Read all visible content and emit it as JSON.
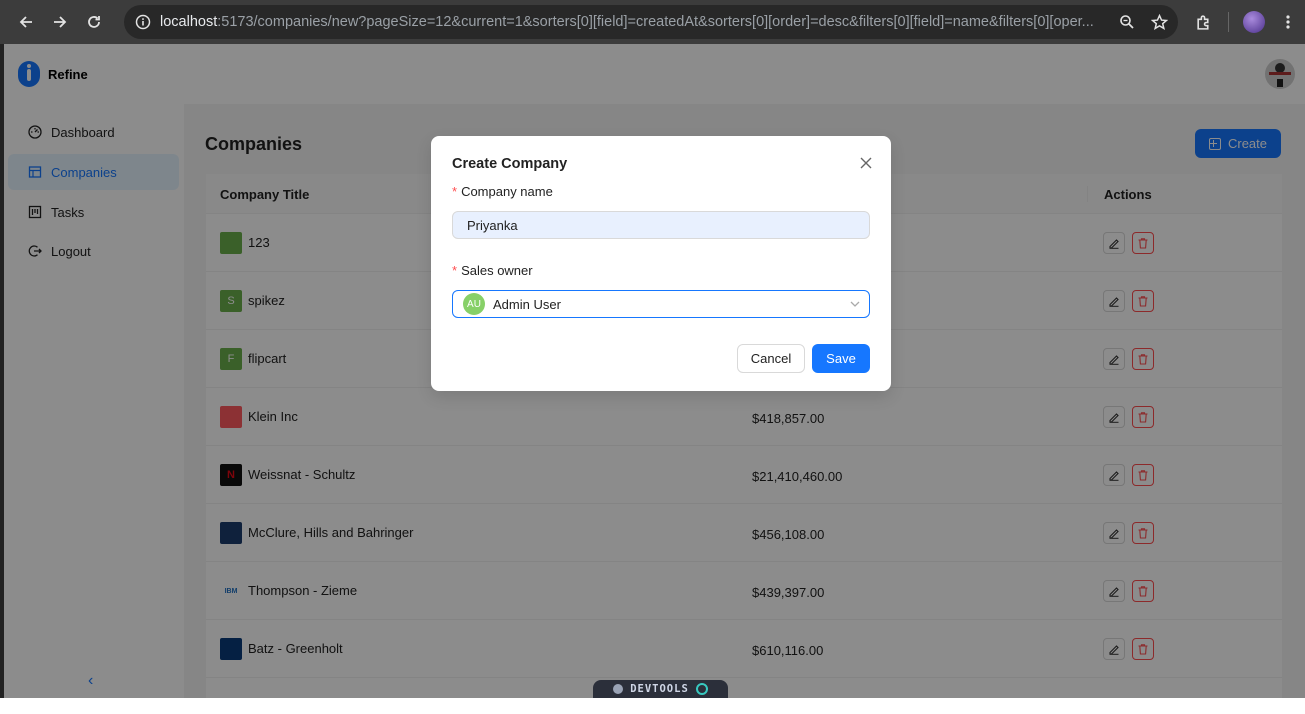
{
  "browser": {
    "url_host": "localhost",
    "url_rest": ":5173/companies/new?pageSize=12&current=1&sorters[0][field]=createdAt&sorters[0][order]=desc&filters[0][field]=name&filters[0][oper..."
  },
  "app": {
    "brand": "Refine",
    "sidebar": {
      "items": [
        {
          "label": "Dashboard",
          "icon": "dashboard-icon"
        },
        {
          "label": "Companies",
          "icon": "companies-icon",
          "active": true
        },
        {
          "label": "Tasks",
          "icon": "tasks-icon"
        },
        {
          "label": "Logout",
          "icon": "logout-icon"
        }
      ],
      "collapse": "‹"
    },
    "page_title": "Companies",
    "create_label": "Create",
    "table": {
      "col_title": "Company Title",
      "col_actions": "Actions",
      "rows": [
        {
          "name": "123",
          "amount": "",
          "logo_text": "",
          "logo_color": "#6ab04c"
        },
        {
          "name": "spikez",
          "amount": "",
          "logo_text": "S",
          "logo_color": "#6ab04c"
        },
        {
          "name": "flipcart",
          "amount": "",
          "logo_text": "F",
          "logo_color": "#6ab04c"
        },
        {
          "name": "Klein Inc",
          "amount": "$418,857.00",
          "logo_text": "",
          "logo_color": "#ff5a5f"
        },
        {
          "name": "Weissnat - Schultz",
          "amount": "$21,410,460.00",
          "logo_text": "N",
          "logo_color": "#111111"
        },
        {
          "name": "McClure, Hills and Bahringer",
          "amount": "$456,108.00",
          "logo_text": "",
          "logo_color": "#1c3d6e"
        },
        {
          "name": "Thompson - Zieme",
          "amount": "$439,397.00",
          "logo_text": "IBM",
          "logo_color": "#ffffff"
        },
        {
          "name": "Batz - Greenholt",
          "amount": "$610,116.00",
          "logo_text": "",
          "logo_color": "#0a3b7a"
        }
      ]
    }
  },
  "modal": {
    "title": "Create Company",
    "name_label": "Company name",
    "name_value": "Priyanka",
    "owner_label": "Sales owner",
    "owner_initials": "AU",
    "owner_value": "Admin User",
    "cancel_label": "Cancel",
    "save_label": "Save",
    "required_mark": "*"
  },
  "devtools_label": "DEVTOOLS",
  "colors": {
    "primary": "#1677ff",
    "danger": "#ff4d4f",
    "avatar_green": "#87d068"
  }
}
